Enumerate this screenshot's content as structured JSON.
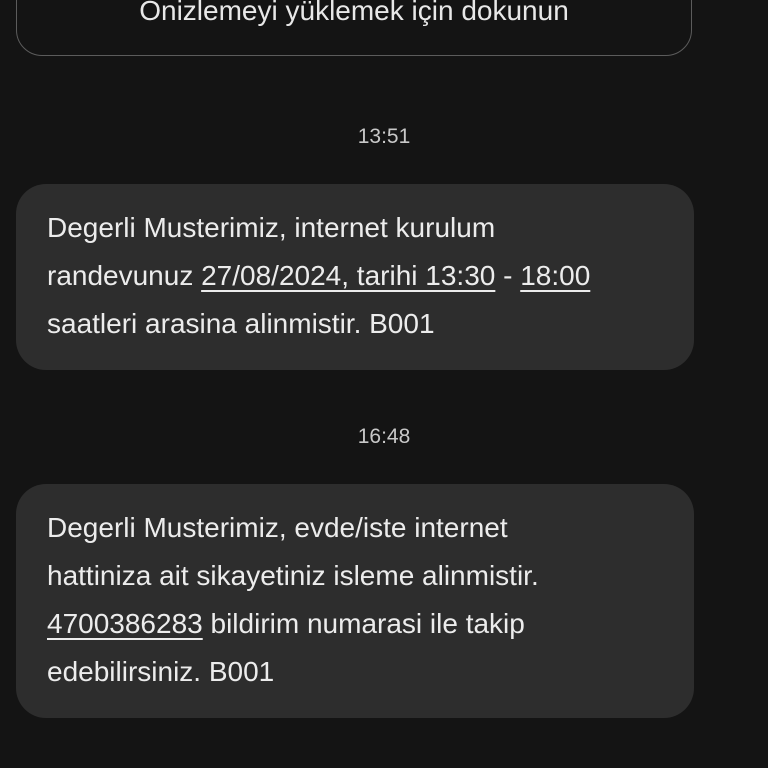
{
  "preview": {
    "text": "Önizlemeyi yüklemek için dokunun"
  },
  "messages": [
    {
      "time": "13:51",
      "line1": "Degerli Musterimiz, internet kurulum",
      "line2_prefix": "randevunuz ",
      "line2_link1": "27/08/2024, tarihi 13:30",
      "line2_sep": " - ",
      "line2_link2": "18:00",
      "line3": "saatleri arasina alinmistir. B001"
    },
    {
      "time": "16:48",
      "line1": "Degerli Musterimiz, evde/iste internet",
      "line2": "hattiniza ait sikayetiniz isleme alinmistir.",
      "line3_link": "4700386283",
      "line3_suffix": " bildirim numarasi ile takip",
      "line4": "edebilirsiniz. B001"
    }
  ]
}
